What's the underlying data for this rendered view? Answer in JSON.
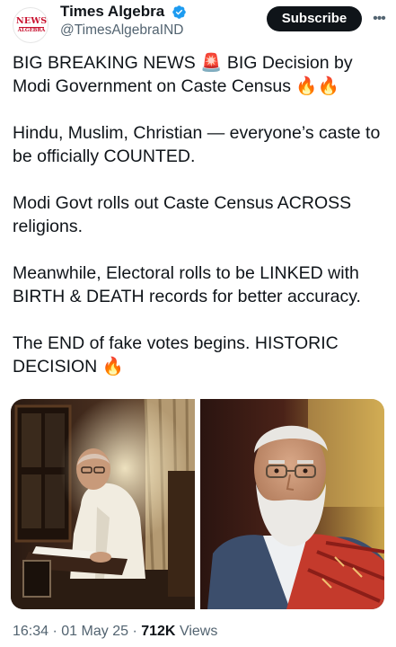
{
  "account": {
    "name": "Times Algebra",
    "handle": "@TimesAlgebraIND",
    "avatar_logo_line1": "NEWS",
    "avatar_logo_line2": "ALGEBRA",
    "verified": true,
    "verified_icon": "verified-badge-icon",
    "verified_color": "#1d9bf0"
  },
  "header": {
    "subscribe_label": "Subscribe",
    "more_icon": "more-options-icon"
  },
  "post": {
    "paragraphs": [
      "BIG BREAKING NEWS 🚨 BIG Decision by Modi Government on Caste Census 🔥🔥",
      "Hindu, Muslim, Christian — everyone’s caste to be officially COUNTED.",
      "Modi Govt rolls out Caste Census ACROSS religions.",
      "Meanwhile, Electoral rolls to be LINKED with BIRTH & DEATH records for better accuracy.",
      "The END of fake votes begins. HISTORIC DECISION 🔥"
    ],
    "images": [
      {
        "name": "man-reading-documents-at-desk-photo"
      },
      {
        "name": "portrait-man-white-beard-glasses-photo"
      }
    ],
    "time": "16:34",
    "date": "01 May 25",
    "views_count": "712K",
    "views_label": "Views"
  },
  "colors": {
    "text_primary": "#0f1419",
    "text_secondary": "#536471",
    "button_bg": "#0f1419",
    "brand_red": "#c8102e"
  }
}
